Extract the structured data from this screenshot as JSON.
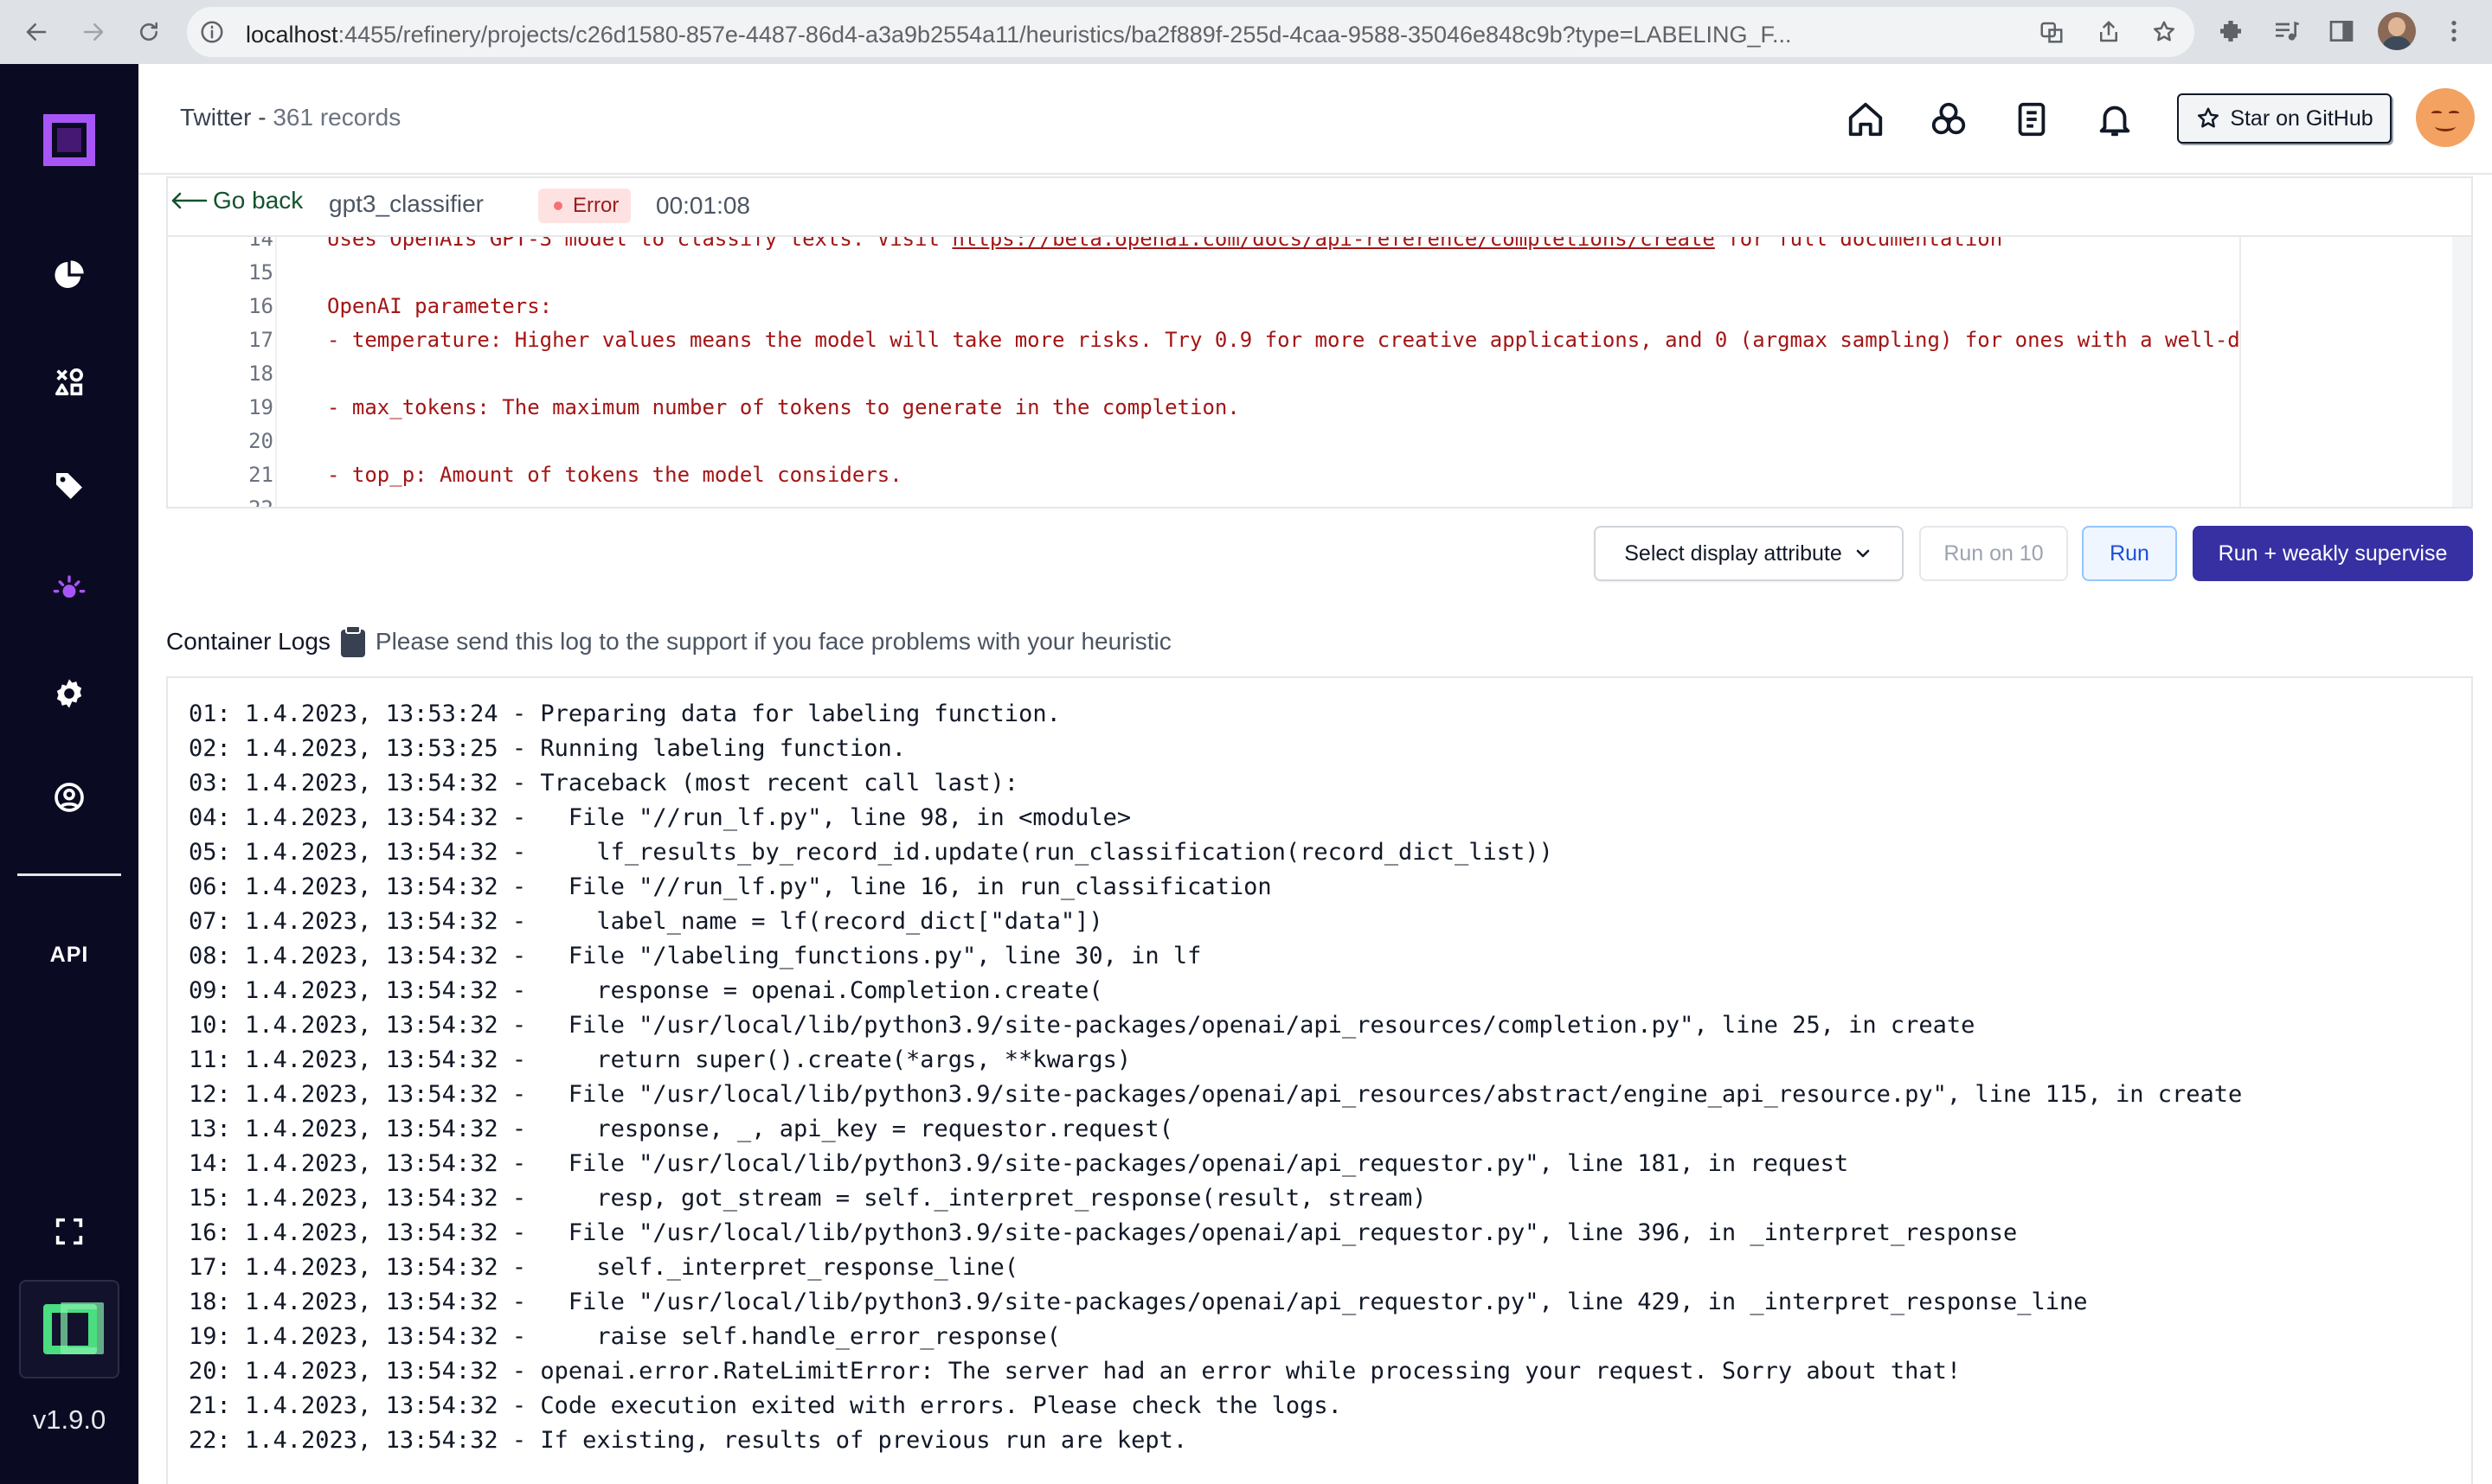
{
  "browser": {
    "url_host": "localhost",
    "url_path": ":4455/refinery/projects/c26d1580-857e-4487-86d4-a3a9b2554a11/heuristics/ba2f889f-255d-4caa-9588-35046e848c9b?type=LABELING_F..."
  },
  "sidebar": {
    "api_label": "API",
    "version": "v1.9.0"
  },
  "header": {
    "project": "Twitter",
    "separator": " - ",
    "records": "361 records",
    "github_label": "Star on GitHub"
  },
  "heuristic": {
    "go_back": "Go back",
    "name": "gpt3_classifier",
    "status": "Error",
    "duration": "00:01:08"
  },
  "editor": {
    "lines": [
      {
        "num": "14",
        "text": "Uses OpenAIs GPT-3 model to classify texts. Visit ",
        "link": "https://beta.openai.com/docs/api-reference/completions/create",
        "after": " for full documentation"
      },
      {
        "num": "15",
        "text": ""
      },
      {
        "num": "16",
        "text": "OpenAI parameters:"
      },
      {
        "num": "17",
        "text": "- temperature: Higher values means the model will take more risks. Try 0.9 for more creative applications, and 0 (argmax sampling) for ones with a well-d"
      },
      {
        "num": "18",
        "text": ""
      },
      {
        "num": "19",
        "text": "- max_tokens: The maximum number of tokens to generate in the completion."
      },
      {
        "num": "20",
        "text": ""
      },
      {
        "num": "21",
        "text": "- top_p: Amount of tokens the model considers."
      },
      {
        "num": "22",
        "text": ""
      }
    ]
  },
  "actions": {
    "select_display": "Select display attribute",
    "run_on_10": "Run on 10",
    "run": "Run",
    "run_weakly": "Run + weakly supervise"
  },
  "logs": {
    "title": "Container Logs",
    "hint": "Please send this log to the support if you face problems with your heuristic",
    "lines": [
      "01: 1.4.2023, 13:53:24 - Preparing data for labeling function.",
      "02: 1.4.2023, 13:53:25 - Running labeling function.",
      "03: 1.4.2023, 13:54:32 - Traceback (most recent call last):",
      "04: 1.4.2023, 13:54:32 -   File \"//run_lf.py\", line 98, in <module>",
      "05: 1.4.2023, 13:54:32 -     lf_results_by_record_id.update(run_classification(record_dict_list))",
      "06: 1.4.2023, 13:54:32 -   File \"//run_lf.py\", line 16, in run_classification",
      "07: 1.4.2023, 13:54:32 -     label_name = lf(record_dict[\"data\"])",
      "08: 1.4.2023, 13:54:32 -   File \"/labeling_functions.py\", line 30, in lf",
      "09: 1.4.2023, 13:54:32 -     response = openai.Completion.create(",
      "10: 1.4.2023, 13:54:32 -   File \"/usr/local/lib/python3.9/site-packages/openai/api_resources/completion.py\", line 25, in create",
      "11: 1.4.2023, 13:54:32 -     return super().create(*args, **kwargs)",
      "12: 1.4.2023, 13:54:32 -   File \"/usr/local/lib/python3.9/site-packages/openai/api_resources/abstract/engine_api_resource.py\", line 115, in create",
      "13: 1.4.2023, 13:54:32 -     response, _, api_key = requestor.request(",
      "14: 1.4.2023, 13:54:32 -   File \"/usr/local/lib/python3.9/site-packages/openai/api_requestor.py\", line 181, in request",
      "15: 1.4.2023, 13:54:32 -     resp, got_stream = self._interpret_response(result, stream)",
      "16: 1.4.2023, 13:54:32 -   File \"/usr/local/lib/python3.9/site-packages/openai/api_requestor.py\", line 396, in _interpret_response",
      "17: 1.4.2023, 13:54:32 -     self._interpret_response_line(",
      "18: 1.4.2023, 13:54:32 -   File \"/usr/local/lib/python3.9/site-packages/openai/api_requestor.py\", line 429, in _interpret_response_line",
      "19: 1.4.2023, 13:54:32 -     raise self.handle_error_response(",
      "20: 1.4.2023, 13:54:32 - openai.error.RateLimitError: The server had an error while processing your request. Sorry about that!",
      "21: 1.4.2023, 13:54:32 - Code execution exited with errors. Please check the logs.",
      "22: 1.4.2023, 13:54:32 - If existing, results of previous run are kept."
    ]
  }
}
